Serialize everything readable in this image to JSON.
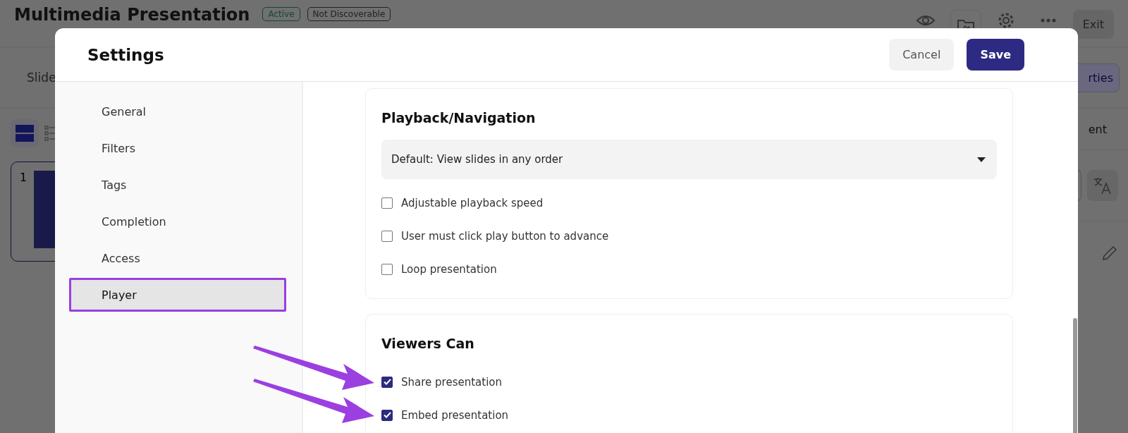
{
  "background_page": {
    "title": "Multimedia Presentation",
    "badges": [
      {
        "label": "Active",
        "color": "#124a32"
      },
      {
        "label": "Not Discoverable",
        "color": "#222222"
      }
    ],
    "exit_button": "Exit",
    "tab_partial": "Slide",
    "button_partial": "rties",
    "column_partial": "ent",
    "slide_number": "1"
  },
  "dialog": {
    "title": "Settings",
    "buttons": [
      {
        "label": "Cancel",
        "kind": "secondary"
      },
      {
        "label": "Save",
        "kind": "primary"
      }
    ],
    "nav": [
      {
        "label": "General",
        "selected": false
      },
      {
        "label": "Filters",
        "selected": false
      },
      {
        "label": "Tags",
        "selected": false
      },
      {
        "label": "Completion",
        "selected": false
      },
      {
        "label": "Access",
        "selected": false
      },
      {
        "label": "Player",
        "selected": true
      }
    ],
    "sections": [
      {
        "title": "Playback/Navigation",
        "dropdown": {
          "value": "Default: View slides in any order"
        },
        "options": [
          {
            "label": "Adjustable playback speed",
            "checked": false,
            "annotated": false
          },
          {
            "label": "User must click play button to advance",
            "checked": false,
            "annotated": false
          },
          {
            "label": "Loop presentation",
            "checked": false,
            "annotated": false
          }
        ]
      },
      {
        "title": "Viewers Can",
        "options": [
          {
            "label": "Share presentation",
            "checked": true,
            "annotated": true
          },
          {
            "label": "Embed presentation",
            "checked": true,
            "annotated": true
          }
        ]
      }
    ]
  }
}
